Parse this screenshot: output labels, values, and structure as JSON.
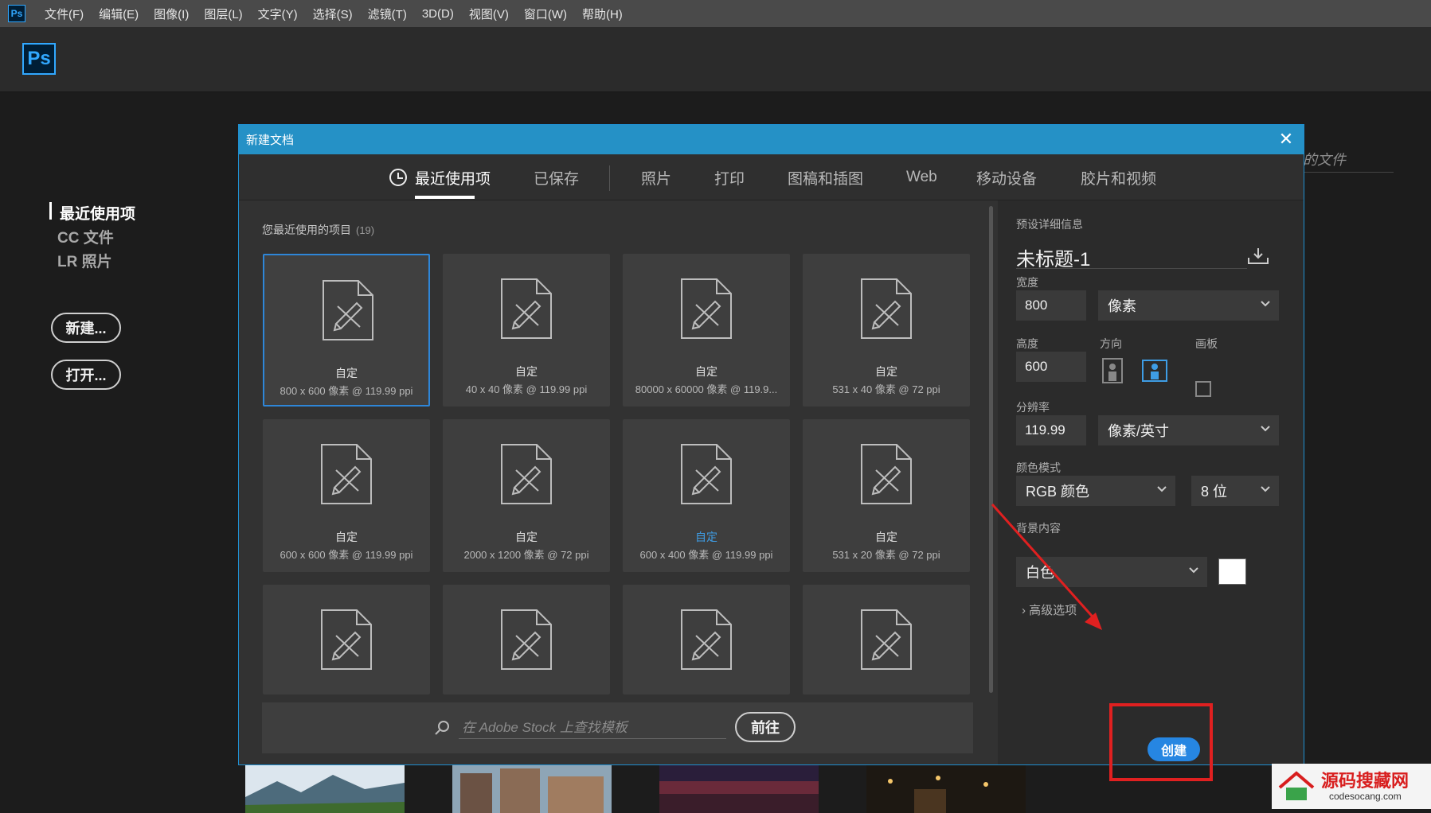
{
  "app": {
    "logo": "Ps"
  },
  "menu": [
    "文件(F)",
    "编辑(E)",
    "图像(I)",
    "图层(L)",
    "文字(Y)",
    "选择(S)",
    "滤镜(T)",
    "3D(D)",
    "视图(V)",
    "窗口(W)",
    "帮助(H)"
  ],
  "start": {
    "nav": [
      "最近使用项",
      "CC 文件",
      "LR 照片"
    ],
    "new_button": "新建...",
    "open_button": "打开...",
    "recent_files_label": "的文件"
  },
  "dialog": {
    "title": "新建文档",
    "tabs": [
      "最近使用项",
      "已保存",
      "照片",
      "打印",
      "图稿和插图",
      "Web",
      "移动设备",
      "胶片和视频"
    ],
    "recent_heading": "您最近使用的项目",
    "recent_count": "(19)",
    "presets": [
      {
        "name": "自定",
        "info": "800 x 600 像素 @ 119.99 ppi"
      },
      {
        "name": "自定",
        "info": "40 x 40 像素 @ 119.99 ppi"
      },
      {
        "name": "自定",
        "info": "80000 x 60000 像素 @ 119.9..."
      },
      {
        "name": "自定",
        "info": "531 x 40 像素 @ 72 ppi"
      },
      {
        "name": "自定",
        "info": "600 x 600 像素 @ 119.99 ppi"
      },
      {
        "name": "自定",
        "info": "2000 x 1200 像素 @ 72 ppi"
      },
      {
        "name": "自定",
        "info": "600 x 400 像素 @ 119.99 ppi"
      },
      {
        "name": "自定",
        "info": "531 x 20 像素 @ 72 ppi"
      }
    ],
    "search_placeholder": "在 Adobe Stock 上查找模板",
    "go_button": "前往",
    "details": {
      "heading": "预设详细信息",
      "doc_name": "未标题-1",
      "width_label": "宽度",
      "width": "800",
      "width_unit": "像素",
      "height_label": "高度",
      "height": "600",
      "orientation_label": "方向",
      "artboard_label": "画板",
      "resolution_label": "分辨率",
      "resolution": "119.99",
      "resolution_unit": "像素/英寸",
      "color_mode_label": "颜色模式",
      "color_mode": "RGB 颜色",
      "bit_depth": "8 位",
      "background_label": "背景内容",
      "background": "白色",
      "advanced": "高级选项",
      "create_button": "创建"
    }
  },
  "watermark": {
    "title": "源码搜藏网",
    "url": "codesocang.com"
  },
  "colors": {
    "accent": "#2686e2",
    "title_bar": "#2591c6",
    "annotation": "#e02020"
  }
}
